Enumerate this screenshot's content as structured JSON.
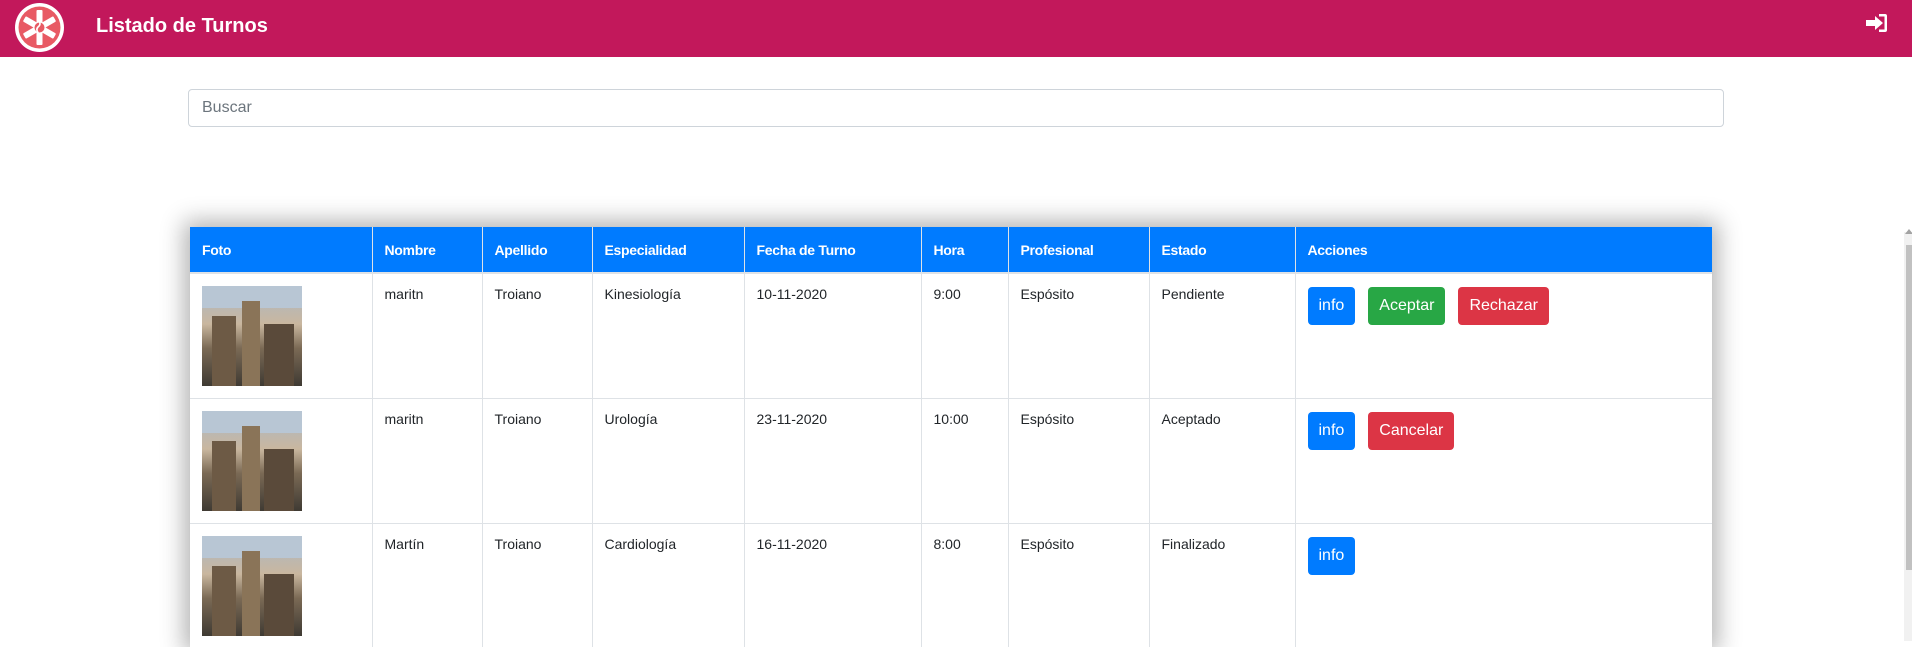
{
  "header": {
    "title": "Listado de Turnos",
    "brand_color": "#c2185b",
    "logo_icon": "medical-star-icon",
    "logout_icon": "sign-out-icon"
  },
  "search": {
    "placeholder": "Buscar",
    "value": ""
  },
  "table": {
    "header_color": "#007bff",
    "columns": [
      "Foto",
      "Nombre",
      "Apellido",
      "Especialidad",
      "Fecha de Turno",
      "Hora",
      "Profesional",
      "Estado",
      "Acciones"
    ],
    "rows": [
      {
        "nombre": "maritn",
        "apellido": "Troiano",
        "especialidad": "Kinesiología",
        "fecha": "10-11-2020",
        "hora": "9:00",
        "profesional": "Espósito",
        "estado": "Pendiente",
        "actions": {
          "info": "info",
          "aceptar": "Aceptar",
          "rechazar": "Rechazar"
        }
      },
      {
        "nombre": "maritn",
        "apellido": "Troiano",
        "especialidad": "Urología",
        "fecha": "23-11-2020",
        "hora": "10:00",
        "profesional": "Espósito",
        "estado": "Aceptado",
        "actions": {
          "info": "info",
          "cancelar": "Cancelar"
        }
      },
      {
        "nombre": "Martín",
        "apellido": "Troiano",
        "especialidad": "Cardiología",
        "fecha": "16-11-2020",
        "hora": "8:00",
        "profesional": "Espósito",
        "estado": "Finalizado",
        "actions": {
          "info": "info"
        }
      }
    ]
  },
  "button_colors": {
    "info": "#007bff",
    "success": "#28a745",
    "danger": "#dc3545"
  }
}
